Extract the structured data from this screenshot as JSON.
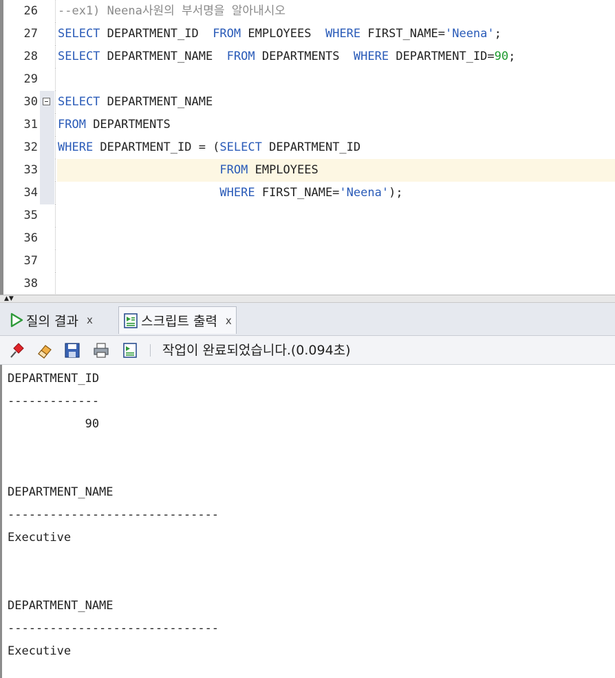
{
  "editor": {
    "lines": [
      {
        "num": "26",
        "tokens": [
          {
            "t": "--ex1) Neena사원의 부서명을 알아내시오",
            "c": "cmt"
          }
        ]
      },
      {
        "num": "27",
        "tokens": [
          {
            "t": "SELECT",
            "c": "kw"
          },
          {
            "t": " DEPARTMENT_ID  ",
            "c": ""
          },
          {
            "t": "FROM",
            "c": "kw"
          },
          {
            "t": " EMPLOYEES  ",
            "c": ""
          },
          {
            "t": "WHERE",
            "c": "kw"
          },
          {
            "t": " FIRST_NAME=",
            "c": ""
          },
          {
            "t": "'Neena'",
            "c": "str"
          },
          {
            "t": ";",
            "c": ""
          }
        ]
      },
      {
        "num": "28",
        "tokens": [
          {
            "t": "SELECT",
            "c": "kw"
          },
          {
            "t": " DEPARTMENT_NAME  ",
            "c": ""
          },
          {
            "t": "FROM",
            "c": "kw"
          },
          {
            "t": " DEPARTMENTS  ",
            "c": ""
          },
          {
            "t": "WHERE",
            "c": "kw"
          },
          {
            "t": " DEPARTMENT_ID=",
            "c": ""
          },
          {
            "t": "90",
            "c": "num"
          },
          {
            "t": ";",
            "c": ""
          }
        ]
      },
      {
        "num": "29",
        "tokens": []
      },
      {
        "num": "30",
        "tokens": [
          {
            "t": "SELECT",
            "c": "kw"
          },
          {
            "t": " DEPARTMENT_NAME",
            "c": ""
          }
        ]
      },
      {
        "num": "31",
        "tokens": [
          {
            "t": "FROM",
            "c": "kw"
          },
          {
            "t": " DEPARTMENTS",
            "c": ""
          }
        ]
      },
      {
        "num": "32",
        "tokens": [
          {
            "t": "WHERE",
            "c": "kw"
          },
          {
            "t": " DEPARTMENT_ID = (",
            "c": ""
          },
          {
            "t": "SELECT",
            "c": "kw"
          },
          {
            "t": " DEPARTMENT_ID",
            "c": ""
          }
        ]
      },
      {
        "num": "33",
        "tokens": [
          {
            "t": "                       ",
            "c": ""
          },
          {
            "t": "FROM",
            "c": "kw"
          },
          {
            "t": " EMPLOYEES",
            "c": ""
          }
        ]
      },
      {
        "num": "34",
        "tokens": [
          {
            "t": "                       ",
            "c": ""
          },
          {
            "t": "WHERE",
            "c": "kw"
          },
          {
            "t": " FIRST_NAME=",
            "c": ""
          },
          {
            "t": "'Neena'",
            "c": "str"
          },
          {
            "t": ");",
            "c": ""
          }
        ]
      },
      {
        "num": "35",
        "tokens": []
      },
      {
        "num": "36",
        "tokens": []
      },
      {
        "num": "37",
        "tokens": []
      },
      {
        "num": "38",
        "tokens": []
      }
    ]
  },
  "tabs": [
    {
      "label": "질의 결과",
      "close": "x",
      "icon": "play-icon"
    },
    {
      "label": "스크립트 출력",
      "close": "x",
      "icon": "script-output-icon"
    }
  ],
  "toolbar": {
    "icons": [
      "pin-icon",
      "eraser-icon",
      "save-icon",
      "print-icon",
      "script-icon"
    ],
    "status": "작업이 완료되었습니다.(0.094초)"
  },
  "output": [
    "DEPARTMENT_ID",
    "-------------",
    "           90",
    "",
    "",
    "DEPARTMENT_NAME",
    "------------------------------",
    "Executive",
    "",
    "",
    "DEPARTMENT_NAME",
    "------------------------------",
    "Executive"
  ],
  "colors": {
    "keyword": "#2a5bb8",
    "number": "#1d9a2e",
    "comment": "#8a8a8a",
    "highlight": "#fdf7e3"
  }
}
